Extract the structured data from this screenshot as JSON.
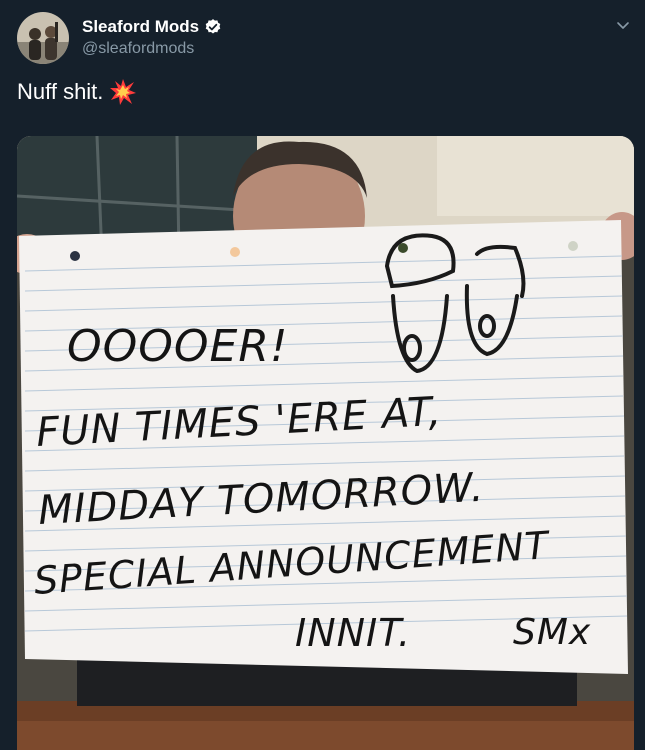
{
  "user": {
    "display_name": "Sleaford Mods",
    "handle": "@sleafordmods",
    "verified": true,
    "avatar_icon": "avatar-photo"
  },
  "tweet": {
    "text": "Nuff shit.",
    "emoji": "collision-emoji"
  },
  "media": {
    "type": "photo",
    "sign_text": [
      "OOOOER!",
      "FUN TIMES 'ERE AT,",
      "MIDDAY TOMORROW.",
      "SPECIAL ANNOUNCEMENT",
      "INNIT.",
      "SMx"
    ]
  },
  "icons": {
    "verified": "verified-badge-icon",
    "menu": "chevron-down-icon"
  },
  "colors": {
    "background": "#15202b",
    "primary_text": "#ffffff",
    "secondary_text": "#8899a6"
  }
}
